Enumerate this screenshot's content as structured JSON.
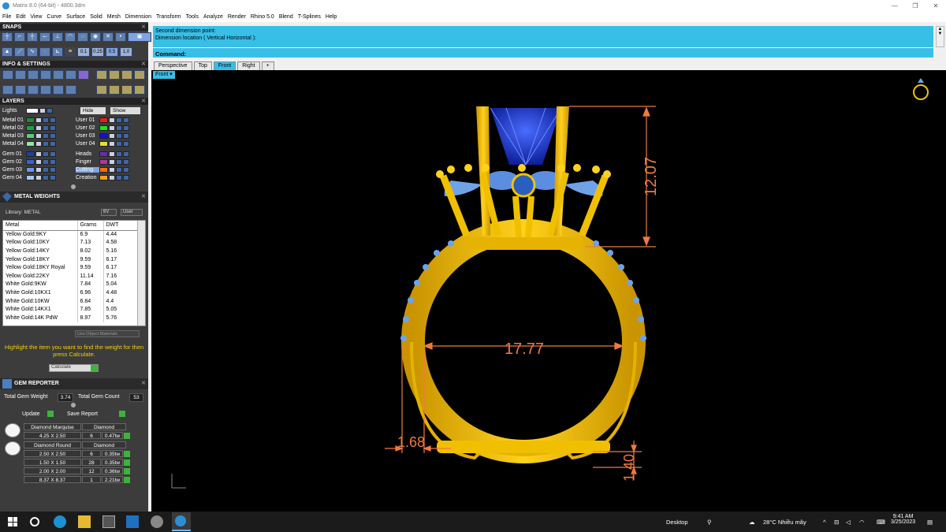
{
  "window": {
    "title": "Matrix 8.0 (64-bit) - 4800.3dm",
    "minimize": "—",
    "restore": "❐",
    "close": "✕"
  },
  "menu": [
    "File",
    "Edit",
    "View",
    "Curve",
    "Surface",
    "Solid",
    "Mesh",
    "Dimension",
    "Transform",
    "Tools",
    "Analyze",
    "Render",
    "Rhino 5.0",
    "Blend",
    "T-Splines",
    "Help"
  ],
  "panels": {
    "snaps_title": "SNAPS",
    "snap_values": [
      "0.1",
      "0.25",
      "0.5",
      "1.0"
    ],
    "info_title": "INFO & SETTINGS",
    "layers_title": "LAYERS",
    "lights_label": "Lights",
    "hide_label": "Hide",
    "show_label": "Show"
  },
  "layers_left": [
    {
      "name": "Metal 01",
      "color": "#1f8a3a"
    },
    {
      "name": "Metal 02",
      "color": "#12a84a"
    },
    {
      "name": "Metal 03",
      "color": "#56d07a"
    },
    {
      "name": "Metal 04",
      "color": "#8fe8a2"
    },
    {
      "name": "Gem 01",
      "color": "#1d3fa8"
    },
    {
      "name": "Gem 02",
      "color": "#3a62d0"
    },
    {
      "name": "Gem 03",
      "color": "#6f95e8"
    },
    {
      "name": "Gem 04",
      "color": "#a8c4f2"
    }
  ],
  "layers_right": [
    {
      "name": "User 01",
      "color": "#e02020"
    },
    {
      "name": "User 02",
      "color": "#20e020"
    },
    {
      "name": "User 03",
      "color": "#1010d8"
    },
    {
      "name": "User 04",
      "color": "#e0e040"
    },
    {
      "name": "Heads",
      "color": "#6a2ca8"
    },
    {
      "name": "Finger",
      "color": "#a83a9a"
    },
    {
      "name": "Cutting",
      "color": "#f07010"
    },
    {
      "name": "Creation",
      "color": "#f0a020"
    }
  ],
  "metal_weights": {
    "title": "METAL WEIGHTS",
    "library_label": "Library: METAL",
    "sel1": "6V",
    "sel2": "User",
    "headers": [
      "Metal",
      "Grams",
      "DWT"
    ],
    "rows": [
      [
        "Yellow Gold:9KY",
        "6.9",
        "4.44"
      ],
      [
        "Yellow Gold:10KY",
        "7.13",
        "4.58"
      ],
      [
        "Yellow Gold:14KY",
        "8.02",
        "5.16"
      ],
      [
        "Yellow Gold:18KY",
        "9.59",
        "6.17"
      ],
      [
        "Yellow Gold:18KY Royal",
        "9.59",
        "6.17"
      ],
      [
        "Yellow Gold:22KY",
        "11.14",
        "7.16"
      ],
      [
        "White Gold:9KW",
        "7.84",
        "5.04"
      ],
      [
        "White Gold:10KX1",
        "6.96",
        "4.48"
      ],
      [
        "White Gold:10KW",
        "6.84",
        "4.4"
      ],
      [
        "White Gold:14KX1",
        "7.85",
        "5.05"
      ],
      [
        "White Gold:14K PdW",
        "8.97",
        "5.76"
      ]
    ],
    "use_object_materials": "Use Object Materials",
    "hint": "Highlight the item you want to find the weight for then press Calculate.",
    "calculate": "Calculate"
  },
  "gem_reporter": {
    "title": "GEM REPORTER",
    "total_weight_label": "Total Gem Weight",
    "total_weight": "3.74",
    "total_count_label": "Total Gem Count",
    "total_count": "53",
    "update": "Update",
    "save_report": "Save Report",
    "groups": [
      {
        "shape": "Diamond Marquise",
        "material": "Diamond",
        "rows": [
          [
            "4.25 X 2.50",
            "6",
            "0.47tw"
          ]
        ]
      },
      {
        "shape": "Diamond Round",
        "material": "Diamond",
        "rows": [
          [
            "2.50 X 2.50",
            "6",
            "0.35tw"
          ],
          [
            "1.50 X 1.50",
            "28",
            "0.35tw"
          ],
          [
            "2.00 X 2.00",
            "12",
            "0.36tw"
          ],
          [
            "8.37 X 8.37",
            "1",
            "2.21tw"
          ]
        ]
      }
    ]
  },
  "command": {
    "history1": "Second dimension point:",
    "history2": "Dimension location ( Vertical  Horizontal ):",
    "label": "Command:"
  },
  "tabs": [
    "Perspective",
    "Top",
    "Front",
    "Right",
    "+"
  ],
  "viewport_label": "Front ▾",
  "dimensions": {
    "head_height": "12.07",
    "inner_diameter": "17.77",
    "shank_width": "1.68",
    "shank_thickness": "1.40"
  },
  "taskbar": {
    "desktop": "Desktop",
    "weather": "28°C  Nhiều mây",
    "time": "9:41 AM",
    "date": "3/25/2023"
  },
  "colors": {
    "accent": "#38bfe8",
    "gold": "#f2c200",
    "gem": "#6fa3e8",
    "dimension": "#f07a3c"
  }
}
